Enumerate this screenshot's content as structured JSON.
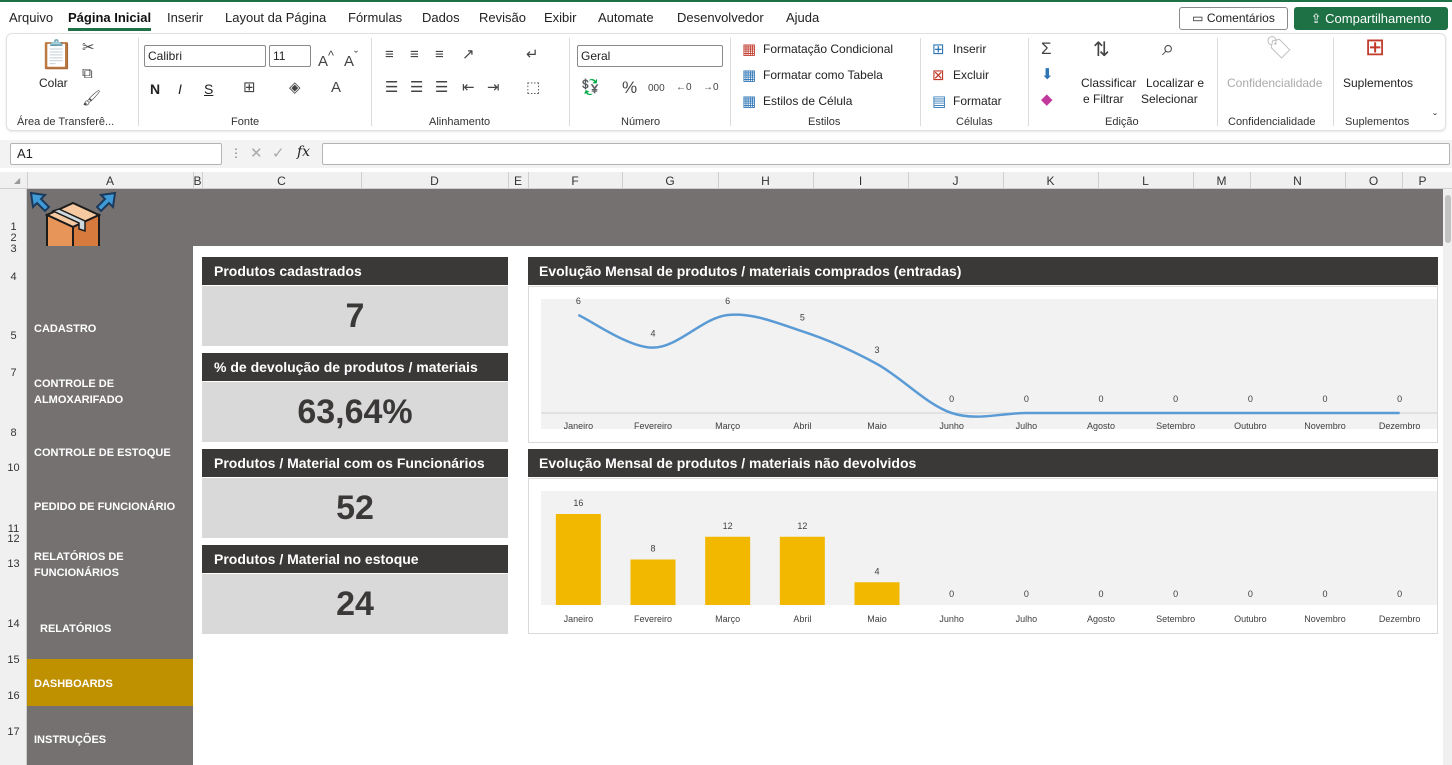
{
  "menu": {
    "items": [
      "Arquivo",
      "Página Inicial",
      "Inserir",
      "Layout da Página",
      "Fórmulas",
      "Dados",
      "Revisão",
      "Exibir",
      "Automate",
      "Desenvolvedor",
      "Ajuda"
    ],
    "comments": "Comentários",
    "share": "Compartilhamento"
  },
  "ribbon": {
    "clipboard": {
      "paste": "Colar",
      "label": "Área de Transferê..."
    },
    "font": {
      "name": "Calibri",
      "size": "11",
      "label": "Fonte",
      "bold": "N",
      "italic": "I",
      "underline": "S"
    },
    "alignment": {
      "label": "Alinhamento"
    },
    "number": {
      "format": "Geral",
      "label": "Número"
    },
    "styles": {
      "conditional": "Formatação Condicional",
      "table": "Formatar como Tabela",
      "cell": "Estilos de Célula",
      "label": "Estilos"
    },
    "cells": {
      "insert": "Inserir",
      "delete": "Excluir",
      "format": "Formatar",
      "label": "Células"
    },
    "editing": {
      "sort1": "Classificar",
      "sort2": "e Filtrar",
      "find1": "Localizar e",
      "find2": "Selecionar",
      "label": "Edição"
    },
    "sensitivity": {
      "button": "Confidencialidade",
      "label": "Confidencialidade"
    },
    "addins": {
      "button": "Suplementos",
      "label": "Suplementos"
    }
  },
  "formula_bar": {
    "name_box": "A1",
    "fx": "fx",
    "value": ""
  },
  "columns": [
    "A",
    "B",
    "C",
    "D",
    "E",
    "F",
    "G",
    "H",
    "I",
    "J",
    "K",
    "L",
    "M",
    "N",
    "O",
    "P"
  ],
  "rows": [
    "1",
    "2",
    "3",
    "4",
    "5",
    "7",
    "8",
    "10",
    "11",
    "12",
    "13",
    "14",
    "15",
    "16",
    "17"
  ],
  "nav": {
    "items": [
      "CADASTRO",
      "CONTROLE DE ALMOXARIFADO",
      "CONTROLE DE ESTOQUE",
      "PEDIDO DE FUNCIONÁRIO",
      "RELATÓRIOS DE FUNCIONÁRIOS",
      "RELATÓRIOS",
      "DASHBOARDS",
      "INSTRUÇÕES"
    ],
    "active": "DASHBOARDS"
  },
  "kpis": [
    {
      "title": "Produtos cadastrados",
      "value": "7"
    },
    {
      "title": "% de devolução de produtos / materiais",
      "value": "63,64%"
    },
    {
      "title": "Produtos / Material com os Funcionários",
      "value": "52"
    },
    {
      "title": "Produtos / Material no estoque",
      "value": "24"
    }
  ],
  "colors": {
    "accent": "#bf9000",
    "line": "#5b9bd5",
    "bar": "#f2b800",
    "header": "#3b3838",
    "sidebar": "#757171"
  },
  "chart_data": [
    {
      "type": "line",
      "title": "Evolução Mensal de produtos / materiais comprados (entradas)",
      "categories": [
        "Janeiro",
        "Fevereiro",
        "Março",
        "Abril",
        "Maio",
        "Junho",
        "Julho",
        "Agosto",
        "Setembro",
        "Outubro",
        "Novembro",
        "Dezembro"
      ],
      "values": [
        6,
        4,
        6,
        5,
        3,
        0,
        0,
        0,
        0,
        0,
        0,
        0
      ]
    },
    {
      "type": "bar",
      "title": "Evolução Mensal de produtos / materiais não devolvidos",
      "categories": [
        "Janeiro",
        "Fevereiro",
        "Março",
        "Abril",
        "Maio",
        "Junho",
        "Julho",
        "Agosto",
        "Setembro",
        "Outubro",
        "Novembro",
        "Dezembro"
      ],
      "values": [
        16,
        8,
        12,
        12,
        4,
        0,
        0,
        0,
        0,
        0,
        0,
        0
      ]
    }
  ]
}
